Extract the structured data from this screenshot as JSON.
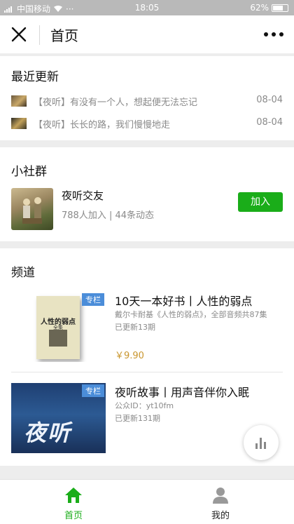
{
  "status_bar": {
    "carrier": "中国移动",
    "dots": "···",
    "time": "18:05",
    "battery": "62%"
  },
  "nav": {
    "title": "首页"
  },
  "recent": {
    "title": "最近更新",
    "items": [
      {
        "text": "【夜听】有没有一个人，想起便无法忘记",
        "date": "08-04"
      },
      {
        "text": "【夜听】长长的路，我们慢慢地走",
        "date": "08-04"
      }
    ]
  },
  "group": {
    "title": "小社群",
    "name": "夜听交友",
    "meta": "788人加入 | 44条动态",
    "join_label": "加入"
  },
  "channels": {
    "title": "频道",
    "items": [
      {
        "badge": "专栏",
        "cover_title": "人性的弱点",
        "cover_subtitle": "全集",
        "title": "10天一本好书丨人性的弱点",
        "desc": "戴尔卡耐基《人性的弱点》，全部音频共87集",
        "updated": "已更新13期",
        "price": "￥9.90"
      },
      {
        "badge": "专栏",
        "cover_text": "夜听",
        "title": "夜听故事丨用声音伴你入眠",
        "account": "公众ID：yt10fm",
        "updated": "已更新131期"
      }
    ]
  },
  "tabs": [
    {
      "label": "首页",
      "icon": "home-icon",
      "active": true
    },
    {
      "label": "我的",
      "icon": "user-icon",
      "active": false
    }
  ],
  "colors": {
    "accent_green": "#1aad19",
    "badge_blue": "#4b8dd9",
    "price_gold": "#c9962e"
  }
}
